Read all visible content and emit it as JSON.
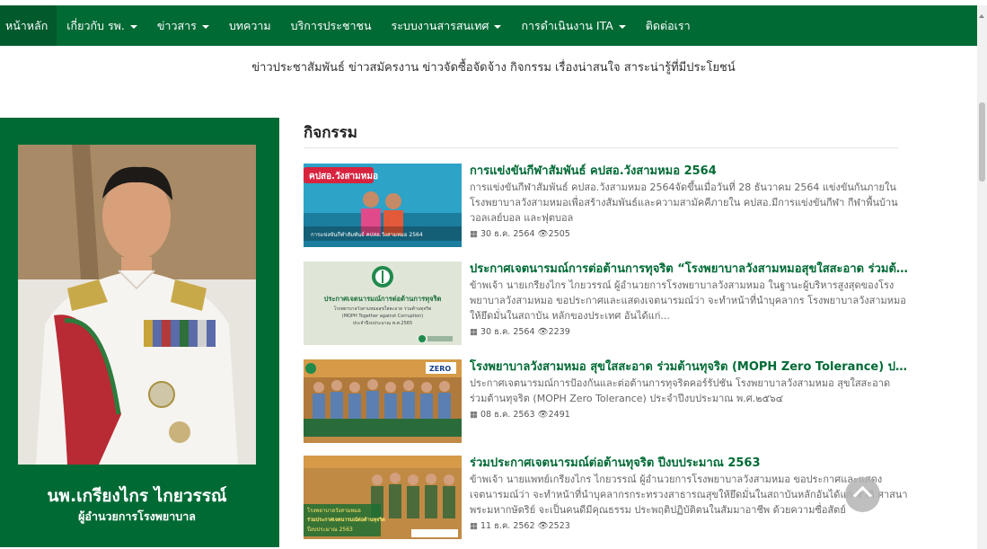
{
  "nav": {
    "items": [
      {
        "label": "หน้าหลัก",
        "dropdown": false,
        "active": true
      },
      {
        "label": "เกี่ยวกับ รพ.",
        "dropdown": true
      },
      {
        "label": "ข่าวสาร",
        "dropdown": true
      },
      {
        "label": "บทความ",
        "dropdown": false
      },
      {
        "label": "บริการประชาชน",
        "dropdown": false
      },
      {
        "label": "ระบบงานสารสนเทศ",
        "dropdown": true
      },
      {
        "label": "การดำเนินงาน ITA",
        "dropdown": true
      },
      {
        "label": "ติดต่อเรา",
        "dropdown": false
      }
    ]
  },
  "header": {
    "subtitle": "ข่าวประชาสัมพันธ์ ข่าวสมัครงาน ข่าวจัดซื้อจัดจ้าง กิจกรรม เรื่องน่าสนใจ สาระน่ารู้ที่มีประโยชน์"
  },
  "director": {
    "name": "นพ.เกรียงไกร ไกยวรรณ์",
    "title": "ผู้อำนวยการโรงพยาบาล"
  },
  "section": {
    "heading": "กิจกรรม"
  },
  "news": [
    {
      "title": "การแข่งขันกีฬาสัมพันธ์ คปสอ.วังสามหมอ 2564",
      "excerpt": "การแข่งขันกีฬาสัมพันธ์ คปสอ.วังสามหมอ 2564จัดขึ้นเมื่อวันที่ 28 ธันวาคม 2564 แข่งขันกันภายในโรงพยาบาลวังสามหมอเพื่อสร้างสัมพันธ์และความสามัคคีภายใน คปสอ.มีการแข่งขันกีฬา กีฬาพื้นบ้าน วอลเลย์บอล และฟุตบอล",
      "date": "30 ธ.ค. 2564",
      "views": "2505",
      "thumb_banner": "คปสอ.วังสามหมอ",
      "thumb_caption": "การแข่งขันกีฬาสัมพันธ์ คปสอ.วังสามหมอ 2564",
      "thumb_color": "#1f8fb5"
    },
    {
      "title": "ประกาศเจตนารมณ์การต่อต้านการทุจริต “โรงพยาบาลวังสามหมอสุขใสสะอาด ร่วมต้านทุจริต",
      "excerpt": "ข้าพเจ้า นายเกรียงไกร ไกยวรรณ์ ผู้อำนวยการโรงพยาบาลวังสามหมอ ในฐานะผู้บริหารสูงสุดของโรงพยาบาลวังสามหมอ ขอประกาศและแสดงเจตนารมณ์ว่า จะทำหน้าที่นำบุคลากร โรงพยาบาลวังสามหมอ ให้ยึดมั่นในสถาบัน หลักของประเทศ อันได้แก่...",
      "date": "30 ธ.ค. 2564",
      "views": "2239",
      "thumb_heading": "ประกาศเจตนารมณ์การต่อต้านการทุจริต",
      "thumb_sub1": "โรงพยาบาลวังสามหมอสุขใสสะอาด ร่วมต้านทุจริต",
      "thumb_sub2": "(MOPH Together against Corruption)",
      "thumb_sub3": "ประจำปีงบประมาณ พ.ศ.2565",
      "thumb_color": "#dfe6d8"
    },
    {
      "title": "โรงพยาบาลวังสามหมอ สุขใสสะอาด ร่วมต้านทุจริต (MOPH Zero Tolerance) ประจำปีงบประมาณ",
      "excerpt": "ประกาศเจตนารมณ์การป้องกันและต่อต้านการทุจริตคอร์รัปชัน โรงพยาบาลวังสามหมอ สุขใสสะอาด ร่วมต้านทุจริต (MOPH Zero Tolerance) ประจำปีงบประมาณ พ.ศ.๒๕๖๔",
      "date": "08 ธ.ค. 2563",
      "views": "2491",
      "thumb_logo": "ZERO",
      "thumb_color": "#b07a3c"
    },
    {
      "title": "ร่วมประกาศเจตนารมณ์ต่อต้านทุจริต ปีงบประมาณ 2563",
      "excerpt": "ข้าพเจ้า นายแพทย์เกรียงไกร ไกยวรรณ์ ผู้อำนวยการโรงพยาบาลวังสามหมอ ขอประกาศและแสดงเจตนารมณ์ว่า จะทำหน้าที่นำบุคลากรกระทรวงสาธารณสุขให้ยึดมั่นในสถาบันหลักอันได้แก่ ชาติ ศาสนา พระมหากษัตริย์ จะเป็นคนดีมีคุณธรรม ประพฤติปฏิบัติตนในสัมมาอาชีพ ด้วยความซื่อสัตย์",
      "date": "11 ธ.ค. 2562",
      "views": "2523",
      "thumb_l1": "โรงพยาบาลวังสามหมอ",
      "thumb_l2": "ร่วมประกาศเจตนารมณ์ต่อต้านทุจริต",
      "thumb_l3": "ปีงบประมาณ 2563",
      "thumb_color": "#c08a45"
    }
  ],
  "colors": {
    "brand_green": "#006a35",
    "link_green": "#006a35"
  }
}
